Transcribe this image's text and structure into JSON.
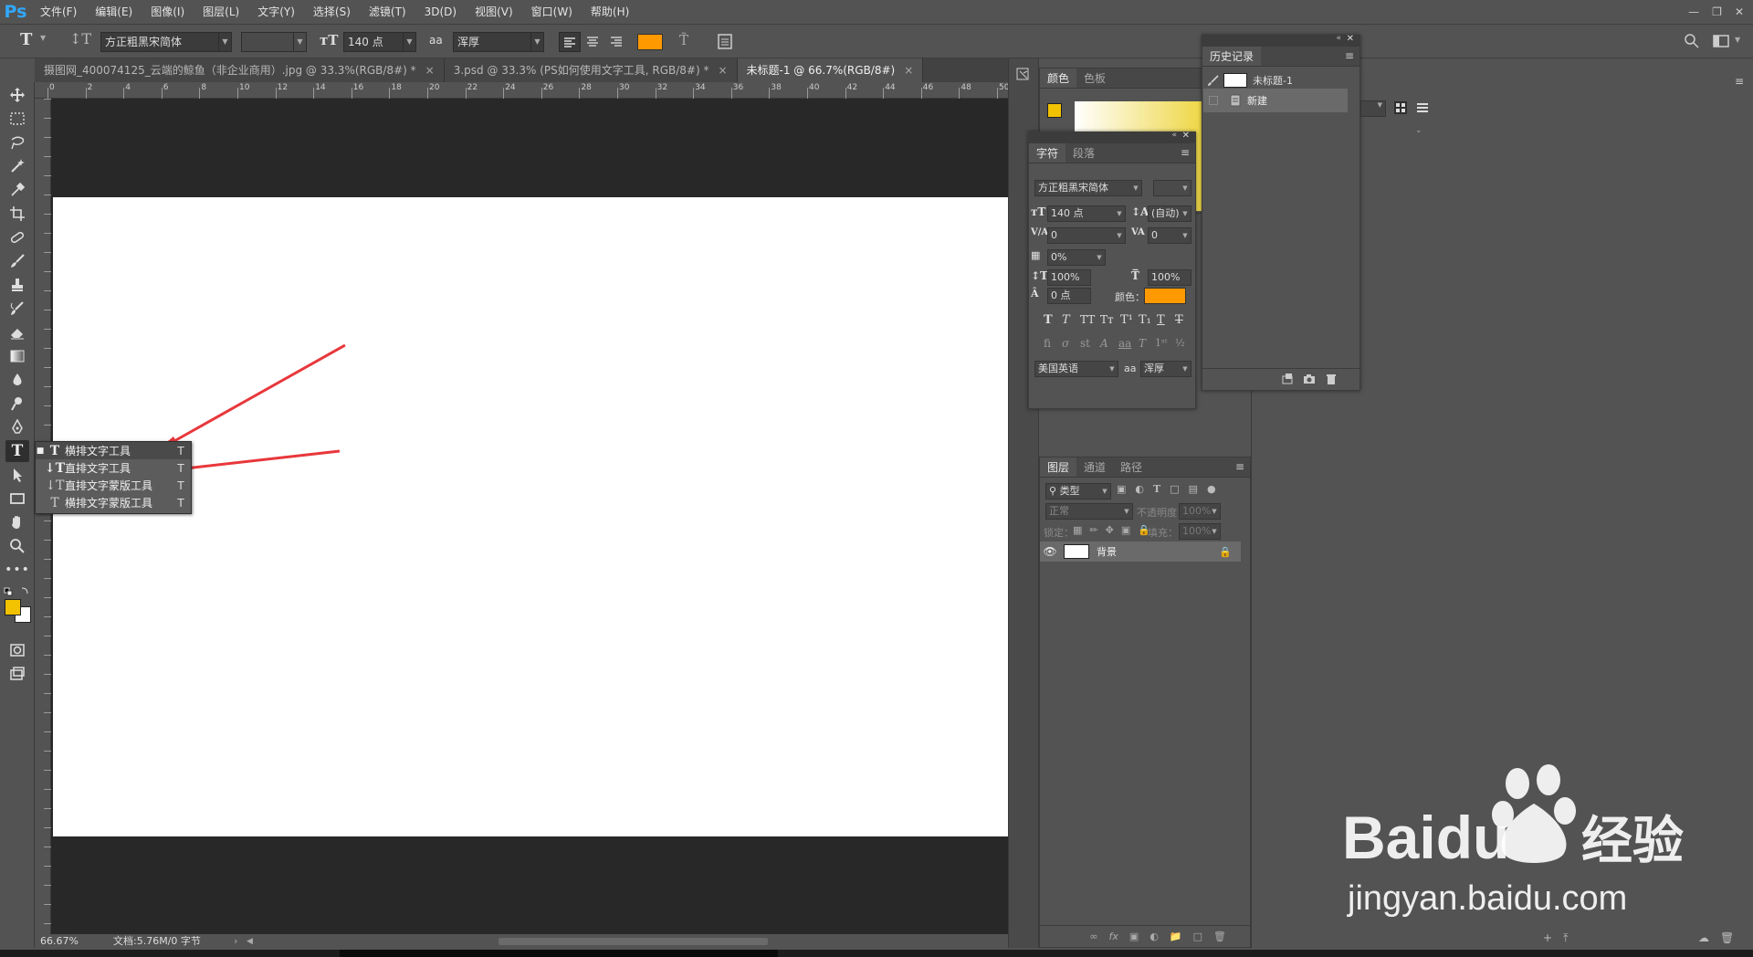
{
  "app": {
    "logo": "Ps"
  },
  "menu": [
    "文件(F)",
    "编辑(E)",
    "图像(I)",
    "图层(L)",
    "文字(Y)",
    "选择(S)",
    "滤镜(T)",
    "3D(D)",
    "视图(V)",
    "窗口(W)",
    "帮助(H)"
  ],
  "options": {
    "font_family": "方正粗黑宋简体",
    "font_style": "",
    "font_size": "140 点",
    "antialias_icon": "aa",
    "antialias": "浑厚",
    "text_color": "#ff9900"
  },
  "tabs": [
    {
      "label": "摄图网_400074125_云端的鲸鱼（非企业商用）.jpg @ 33.3%(RGB/8#) *",
      "close": "×"
    },
    {
      "label": "3.psd @ 33.3% (PS如何使用文字工具, RGB/8#) *",
      "close": "×"
    },
    {
      "label": "未标题-1 @ 66.7%(RGB/8#)",
      "close": "×"
    }
  ],
  "ruler_top": [
    "0",
    "2",
    "4",
    "6",
    "8",
    "10",
    "12",
    "14",
    "16",
    "18",
    "20",
    "22",
    "24",
    "26",
    "28",
    "30",
    "32",
    "34",
    "36",
    "38",
    "40",
    "42",
    "44",
    "46",
    "48",
    "50"
  ],
  "flyout": [
    {
      "label": "横排文字工具",
      "key": "T"
    },
    {
      "label": "直排文字工具",
      "key": "T"
    },
    {
      "label": "直排文字蒙版工具",
      "key": "T"
    },
    {
      "label": "横排文字蒙版工具",
      "key": "T"
    }
  ],
  "status": {
    "zoom": "66.67%",
    "doc": "文档:5.76M/0 字节"
  },
  "color_panel": {
    "tabs": [
      "颜色",
      "色板"
    ],
    "fg": "#f2c200"
  },
  "character_panel": {
    "tabs": [
      "字符",
      "段落"
    ],
    "font_family": "方正粗黑宋简体",
    "font_size": "140 点",
    "leading": "(自动)",
    "kerning": "0",
    "tracking": "0",
    "scale_pct": "0%",
    "vertical_scale": "100%",
    "horizontal_scale": "100%",
    "baseline": "0 点",
    "color_label": "颜色：",
    "color": "#ff9900",
    "language": "美国英语",
    "aa_icon": "aa",
    "antialias": "浑厚"
  },
  "history_panel": {
    "title": "历史记录",
    "snapshot": "未标题-1",
    "items": [
      "新建"
    ]
  },
  "layers_panel": {
    "tabs": [
      "图层",
      "通道",
      "路径"
    ],
    "filter": "类型",
    "blend": "正常",
    "opacity_label": "不透明度：",
    "opacity": "100%",
    "lock_label": "锁定：",
    "fill_label": "填充：",
    "fill": "100%",
    "layers": [
      {
        "name": "背景"
      }
    ]
  },
  "watermark": {
    "brand": "Baidu",
    "brand_cn": "经验",
    "url": "jingyan.baidu.com"
  }
}
